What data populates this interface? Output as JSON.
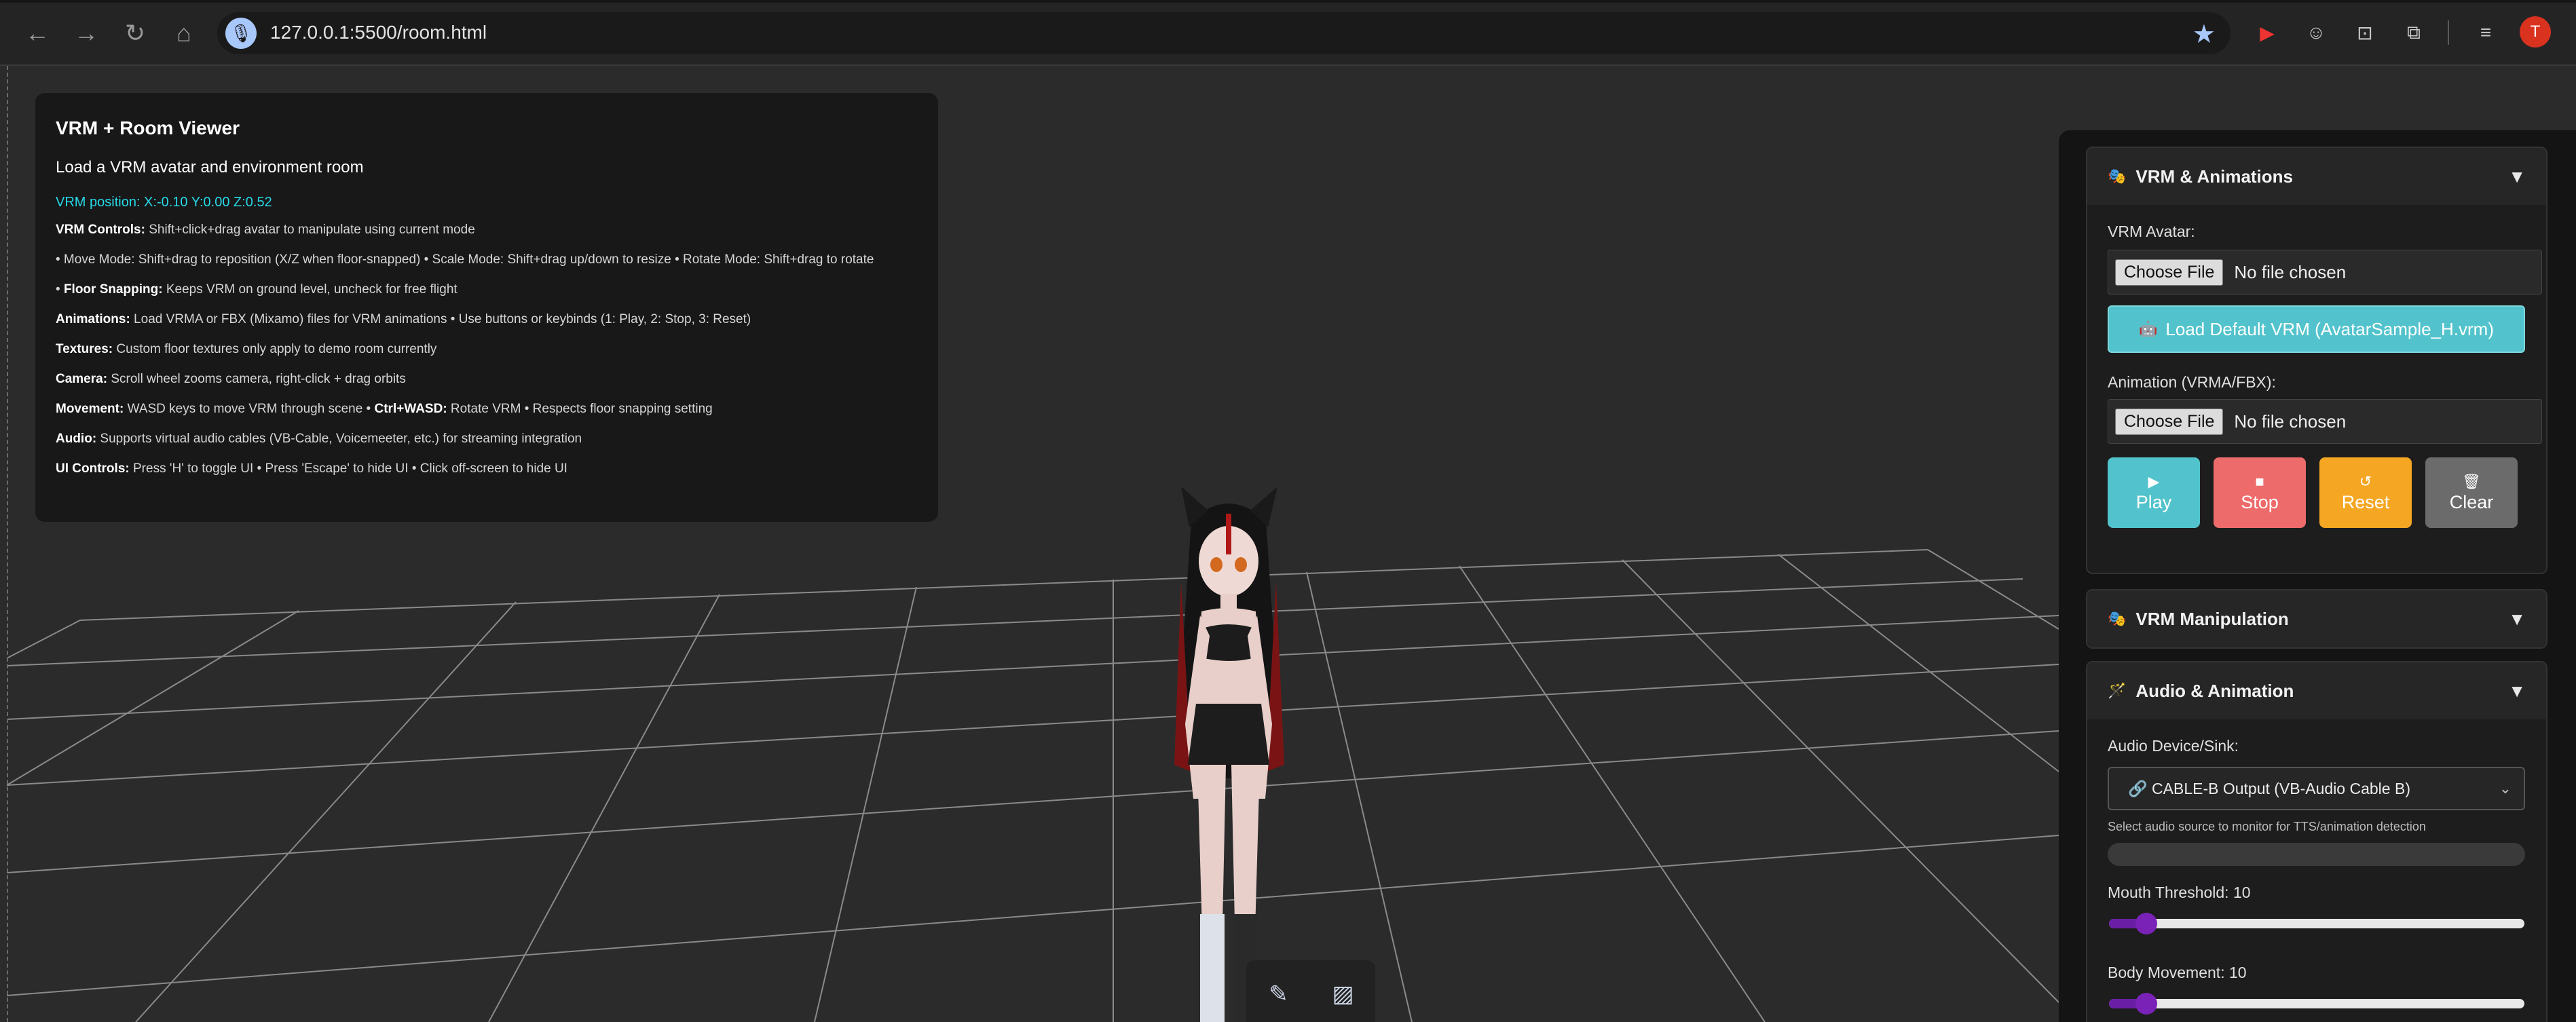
{
  "browser": {
    "url": "127.0.0.1:5500/room.html",
    "profile_initial": "T",
    "icons": [
      "back-icon",
      "forward-icon",
      "reload-icon",
      "home-icon",
      "mic-icon",
      "star-icon"
    ]
  },
  "info": {
    "title": "VRM + Room Viewer",
    "subtitle": "Load a VRM avatar and environment room",
    "position": "VRM position: X:-0.10 Y:0.00 Z:0.52",
    "lines": [
      {
        "label": "VRM Controls:",
        "text": " Shift+click+drag avatar to manipulate using current mode"
      },
      {
        "label": "",
        "text": "• Move Mode: Shift+drag to reposition (X/Z when floor-snapped) • Scale Mode: Shift+drag up/down to resize • Rotate Mode: Shift+drag to rotate"
      },
      {
        "label": "",
        "prefix": "• ",
        "label2": "Floor Snapping:",
        "text": " Keeps VRM on ground level, uncheck for free flight"
      },
      {
        "label": "Animations:",
        "text": " Load VRMA or FBX (Mixamo) files for VRM animations • Use buttons or keybinds (1: Play, 2: Stop, 3: Reset)"
      },
      {
        "label": "Textures:",
        "text": " Custom floor textures only apply to demo room currently"
      },
      {
        "label": "Camera:",
        "text": " Scroll wheel zooms camera, right-click + drag orbits"
      },
      {
        "label": "Movement:",
        "text": " WASD keys to move VRM through scene • ",
        "label3": "Ctrl+WASD:",
        "text2": " Rotate VRM • Respects floor snapping setting"
      },
      {
        "label": "Audio:",
        "text": " Supports virtual audio cables (VB-Cable, Voicemeeter, etc.) for streaming integration"
      },
      {
        "label": "UI Controls:",
        "text": " Press 'H' to toggle UI • Press 'Escape' to hide UI • Click off-screen to hide UI"
      }
    ]
  },
  "panel": {
    "vrm_section": {
      "title": "VRM & Animations",
      "avatar_label": "VRM Avatar:",
      "choose_file": "Choose File",
      "no_file": "No file chosen",
      "load_default": "Load Default VRM (AvatarSample_H.vrm)",
      "anim_label": "Animation (VRMA/FBX):",
      "buttons": [
        {
          "label": "Play",
          "color": "#52c3cc",
          "icon": "▶"
        },
        {
          "label": "Stop",
          "color": "#ee6b6b",
          "icon": "■"
        },
        {
          "label": "Reset",
          "color": "#f5a623",
          "icon": "↺"
        },
        {
          "label": "Clear",
          "color": "#6b6b6b",
          "icon": "🗑"
        }
      ]
    },
    "manip_section": {
      "title": "VRM Manipulation"
    },
    "audio_section": {
      "title": "Audio & Animation",
      "device_label": "Audio Device/Sink:",
      "device_value": "🔗  CABLE-B Output (VB-Audio Cable B)",
      "hint": "Select audio source to monitor for TTS/animation detection",
      "mouth_label": "Mouth Threshold: 10",
      "mouth_value": 0.09,
      "body_label": "Body Movement: 10",
      "body_value": 0.09
    }
  },
  "colors": {
    "accent_cyan": "#27d9e8",
    "slider_purple": "#6a1ea6"
  }
}
